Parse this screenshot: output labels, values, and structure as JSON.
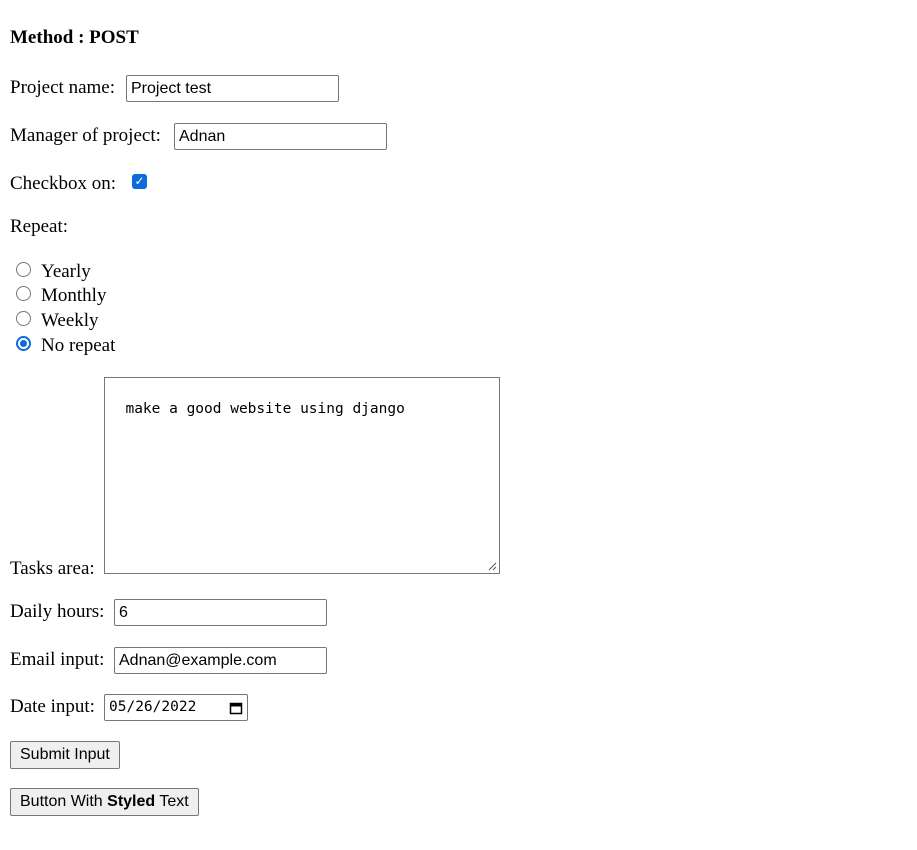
{
  "heading": "Method : POST",
  "project_name": {
    "label": "Project name:",
    "value": "Project test"
  },
  "manager": {
    "label": "Manager of project:",
    "value": "Adnan"
  },
  "checkbox": {
    "label": "Checkbox on:",
    "checked": true
  },
  "repeat": {
    "label": "Repeat:",
    "options": [
      {
        "label": "Yearly",
        "selected": false
      },
      {
        "label": "Monthly",
        "selected": false
      },
      {
        "label": "Weekly",
        "selected": false
      },
      {
        "label": "No repeat",
        "selected": true
      }
    ]
  },
  "tasks": {
    "label": "Tasks area:",
    "value": "make a good website using django"
  },
  "daily_hours": {
    "label": "Daily hours:",
    "value": "6"
  },
  "email": {
    "label": "Email input:",
    "value": "Adnan@example.com"
  },
  "date": {
    "label": "Date input:",
    "value": "05/26/2022"
  },
  "buttons": {
    "submit": "Submit Input",
    "styled_before": "Button With",
    "styled_bold": "Styled",
    "styled_after": "Text"
  },
  "colors": {
    "accent": "#0b6cda",
    "border": "#767676",
    "button_bg": "#efefef"
  }
}
